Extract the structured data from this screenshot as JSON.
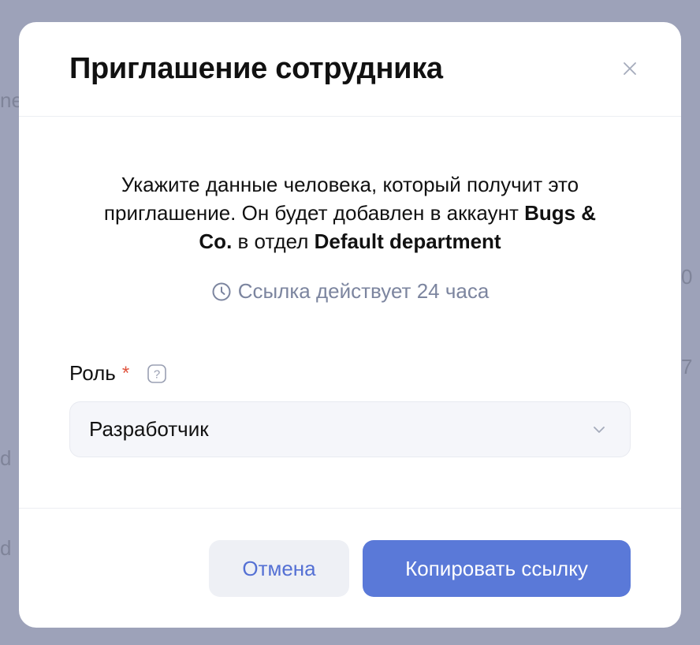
{
  "background": {
    "fragments": [
      "ne",
      "0",
      "7",
      "d",
      "d"
    ]
  },
  "modal": {
    "title": "Приглашение сотрудника",
    "description": {
      "prefix": "Укажите данные человека, который получит это приглашение. Он будет добавлен в аккаунт ",
      "account": "Bugs & Co.",
      "middle": " в отдел ",
      "department": "Default department"
    },
    "validity": "Ссылка действует 24 часа",
    "role": {
      "label": "Роль",
      "required_mark": "*",
      "help_glyph": "?",
      "selected": "Разработчик"
    },
    "buttons": {
      "cancel": "Отмена",
      "copy": "Копировать ссылку"
    }
  },
  "icons": {
    "close": "close-icon",
    "clock": "clock-icon",
    "help": "question-icon",
    "chevron": "chevron-down-icon"
  },
  "colors": {
    "accent": "#5a79d8",
    "muted": "#7c859f",
    "required": "#e0533d",
    "overlay": "#9da2b9"
  }
}
